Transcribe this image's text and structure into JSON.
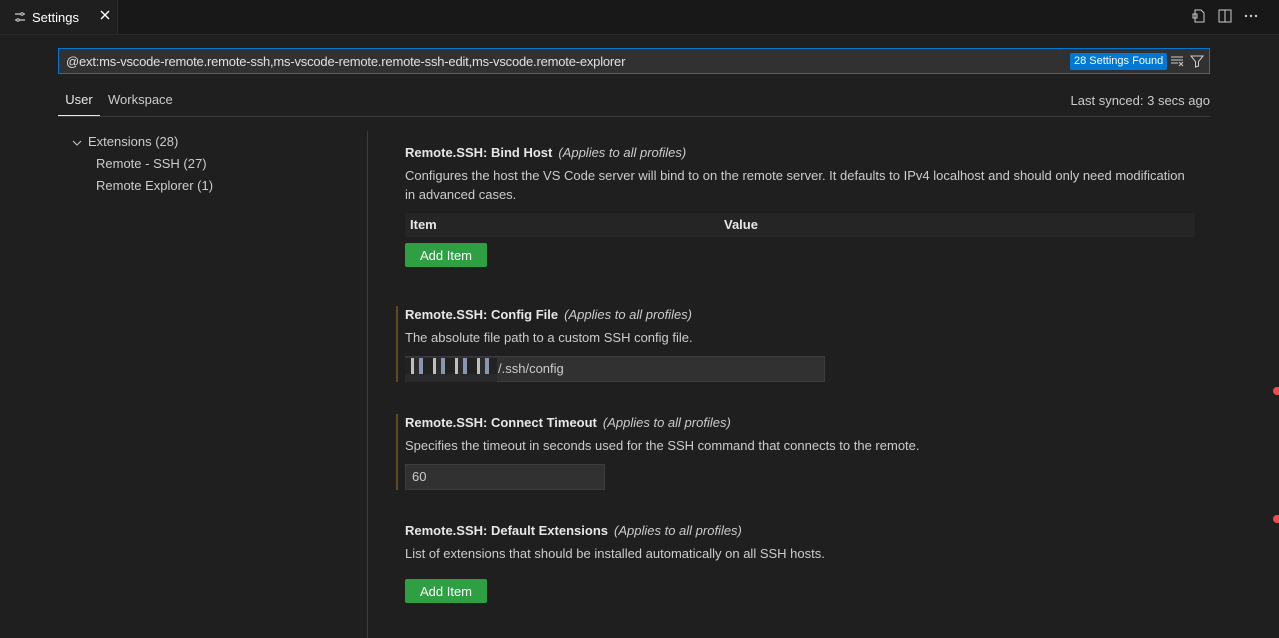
{
  "tab": {
    "label": "Settings",
    "icon": "settings-icon",
    "close_icon": "close-icon"
  },
  "toolbar_actions": [
    "open-json-icon",
    "split-editor-icon",
    "more-actions-icon"
  ],
  "search": {
    "value": "@ext:ms-vscode-remote.remote-ssh,ms-vscode-remote.remote-ssh-edit,ms-vscode.remote-explorer",
    "results_badge": "28 Settings Found"
  },
  "scope": {
    "user": "User",
    "workspace": "Workspace",
    "sync_status": "Last synced: 3 secs ago"
  },
  "toc": [
    {
      "label": "Extensions (28)"
    },
    {
      "label": "Remote - SSH (27)"
    },
    {
      "label": "Remote Explorer (1)"
    }
  ],
  "settings": {
    "bind_host": {
      "title": "Remote.SSH: Bind Host",
      "scope_note": "(Applies to all profiles)",
      "description": "Configures the host the VS Code server will bind to on the remote server. It defaults to IPv4 localhost and should only need modification in advanced cases.",
      "col_item": "Item",
      "col_value": "Value",
      "add_label": "Add Item"
    },
    "config_file": {
      "title": "Remote.SSH: Config File",
      "scope_note": "(Applies to all profiles)",
      "description": "The absolute file path to a custom SSH config file.",
      "value": "/.ssh/config"
    },
    "connect_timeout": {
      "title": "Remote.SSH: Connect Timeout",
      "scope_note": "(Applies to all profiles)",
      "description": "Specifies the timeout in seconds used for the SSH command that connects to the remote.",
      "value": "60"
    },
    "default_extensions": {
      "title": "Remote.SSH: Default Extensions",
      "scope_note": "(Applies to all profiles)",
      "description": "List of extensions that should be installed automatically on all SSH hosts.",
      "add_label": "Add Item"
    }
  },
  "colors": {
    "accent": "#0078d4",
    "add_button": "#2ea043",
    "modified_marker": "#5f4b1f",
    "error_marker": "#f14c4c"
  }
}
